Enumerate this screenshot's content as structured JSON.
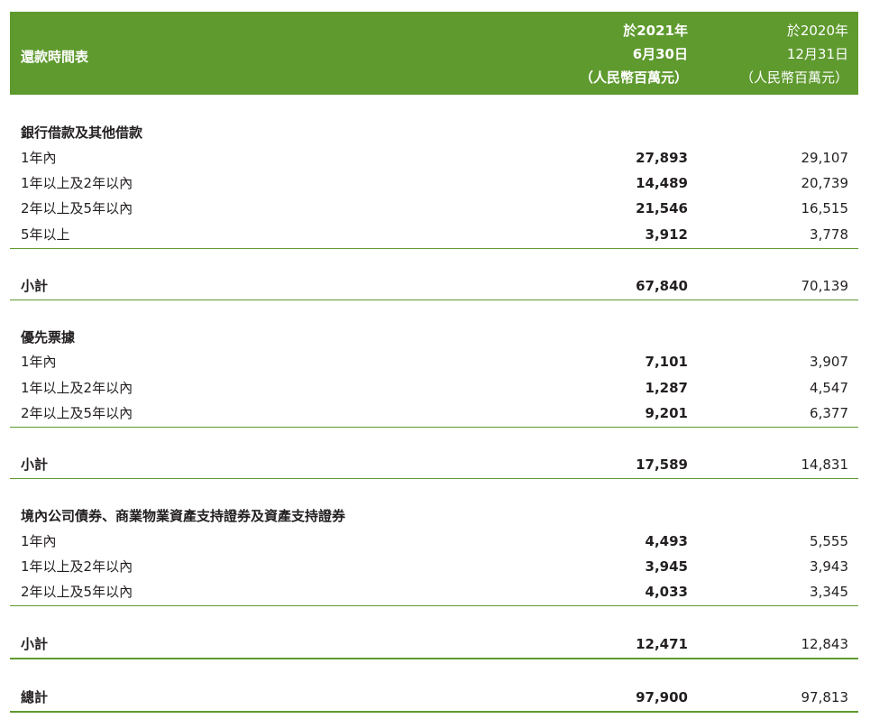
{
  "header": {
    "title": "還款時間表",
    "col1": [
      "於2021年",
      "6月30日",
      "（人民幣百萬元）"
    ],
    "col2": [
      "於2020年",
      "12月31日",
      "（人民幣百萬元）"
    ]
  },
  "sections": [
    {
      "title": "銀行借款及其他借款",
      "rows": [
        {
          "label": "1年內",
          "v1": "27,893",
          "v2": "29,107"
        },
        {
          "label": "1年以上及2年以內",
          "v1": "14,489",
          "v2": "20,739"
        },
        {
          "label": "2年以上及5年以內",
          "v1": "21,546",
          "v2": "16,515"
        },
        {
          "label": "5年以上",
          "v1": "3,912",
          "v2": "3,778"
        }
      ],
      "subtotal": {
        "label": "小計",
        "v1": "67,840",
        "v2": "70,139"
      }
    },
    {
      "title": "優先票據",
      "rows": [
        {
          "label": "1年內",
          "v1": "7,101",
          "v2": "3,907"
        },
        {
          "label": "1年以上及2年以內",
          "v1": "1,287",
          "v2": "4,547"
        },
        {
          "label": "2年以上及5年以內",
          "v1": "9,201",
          "v2": "6,377"
        }
      ],
      "subtotal": {
        "label": "小計",
        "v1": "17,589",
        "v2": "14,831"
      }
    },
    {
      "title": "境內公司債券、商業物業資產支持證券及資產支持證券",
      "rows": [
        {
          "label": "1年內",
          "v1": "4,493",
          "v2": "5,555"
        },
        {
          "label": "1年以上及2年以內",
          "v1": "3,945",
          "v2": "3,943"
        },
        {
          "label": "2年以上及5年以內",
          "v1": "4,033",
          "v2": "3,345"
        }
      ],
      "subtotal": {
        "label": "小計",
        "v1": "12,471",
        "v2": "12,843"
      }
    }
  ],
  "total": {
    "label": "總計",
    "v1": "97,900",
    "v2": "97,813"
  },
  "colors": {
    "header_bg": "#5f9a2f",
    "rule": "#5f9a2f"
  }
}
